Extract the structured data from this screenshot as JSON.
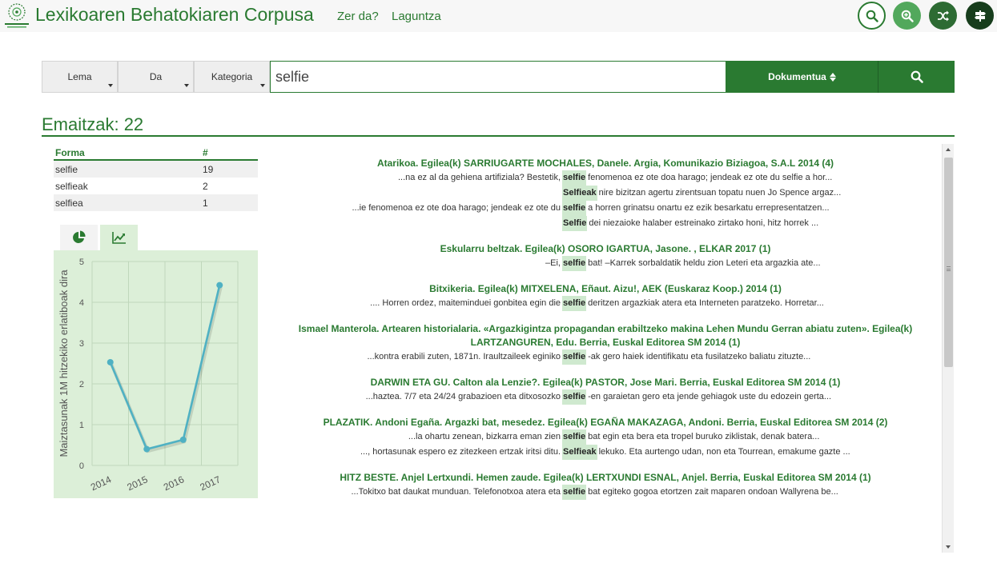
{
  "header": {
    "title": "Lexikoaren Behatokiaren Corpusa",
    "nav": [
      "Zer da?",
      "Laguntza"
    ],
    "icons": [
      "search-icon",
      "zoom-in-icon",
      "shuffle-icon",
      "signpost-icon"
    ],
    "colors": {
      "primary": "#2a7a31",
      "light": "#52a85c",
      "mid": "#2d6b33",
      "dark": "#173d1c"
    }
  },
  "search": {
    "dropdowns": [
      "Lema",
      "Da",
      "Kategoria"
    ],
    "query": "selfie",
    "sort_label": "Dokumentua"
  },
  "results": {
    "title": "Emaitzak: 22"
  },
  "forms": {
    "headers": [
      "Forma",
      "#"
    ],
    "rows": [
      {
        "form": "selfie",
        "count": "19"
      },
      {
        "form": "selfieak",
        "count": "2"
      },
      {
        "form": "selfiea",
        "count": "1"
      }
    ]
  },
  "chart_tabs": [
    "pie-chart-icon",
    "line-chart-icon"
  ],
  "chart_data": {
    "type": "line",
    "categories": [
      "2014",
      "2015",
      "2016",
      "2017"
    ],
    "series": [
      {
        "values": [
          2.53,
          0.4,
          0.63,
          4.42
        ]
      }
    ],
    "ylabel": "Maiztasunak 1M hitzekiko erlatiboak dira",
    "xlabel": "",
    "ylim": [
      0,
      5
    ],
    "yticks": [
      "0",
      "1",
      "2",
      "3",
      "4",
      "5"
    ],
    "grid": true,
    "line_color": "#4fb1c3"
  },
  "documents": [
    {
      "title": "Atarikoa. Egilea(k) SARRIUGARTE MOCHALES, Danele. Argia, Komunikazio Biziagoa, S.A.L 2014 (4)",
      "lines": [
        {
          "left": "...na ez al da gehiena artifiziala? Bestetik,",
          "kw": "selfie",
          "right": "fenomenoa ez ote doa harago; jendeak ez ote du selfie a hor..."
        },
        {
          "left": "",
          "kw": "Selfieak",
          "right": "nire bizitzan agertu zirentsuan topatu nuen Jo Spence argaz..."
        },
        {
          "left": "...ie fenomenoa ez ote doa harago; jendeak ez ote du",
          "kw": "selfie",
          "right": "a horren grinatsu onartu ez ezik besarkatu errepresentatzen..."
        },
        {
          "left": "",
          "kw": "Selfie",
          "right": "dei niezaioke halaber estreinako zirtako honi, hitz horrek ..."
        }
      ]
    },
    {
      "title": "Eskularru beltzak. Egilea(k) OSORO IGARTUA, Jasone. , ELKAR 2017 (1)",
      "lines": [
        {
          "left": "–Ei,",
          "kw": "selfie",
          "right": "bat! –Karrek sorbaldatik heldu zion Leteri eta argazkia ate..."
        }
      ]
    },
    {
      "title": "Bitxikeria. Egilea(k) MITXELENA, Eñaut. Aizu!, AEK (Euskaraz Koop.) 2014 (1)",
      "lines": [
        {
          "left": ".... Horren ordez, maiteminduei gonbitea egin die",
          "kw": "selfie",
          "right": "deritzen argazkiak atera eta Interneten paratzeko. Horretar..."
        }
      ]
    },
    {
      "title": "Ismael Manterola. Artearen historialaria. «Argazkigintza propagandan erabiltzeko makina Lehen Mundu Gerran abiatu zuten». Egilea(k) LARTZANGUREN, Edu. Berria, Euskal Editorea SM 2014 (1)",
      "lines": [
        {
          "left": "...kontra erabili zuten, 1871n. Iraultzaileek eginiko",
          "kw": "selfie",
          "right": "-ak gero haiek identifikatu eta fusilatzeko baliatu zituzte..."
        }
      ]
    },
    {
      "title": "DARWIN ETA GU. Calton ala Lenzie?. Egilea(k) PASTOR, Jose Mari. Berria, Euskal Editorea SM 2014 (1)",
      "lines": [
        {
          "left": "...haztea. 7/7 eta 24/24 grabazioen eta ditxosozko",
          "kw": "selfie",
          "right": "-en garaietan gero eta jende gehiagok uste du edozein gerta..."
        }
      ]
    },
    {
      "title": "PLAZATIK. Andoni Egaña. Argazki bat, mesedez. Egilea(k) EGAÑA MAKAZAGA, Andoni. Berria, Euskal Editorea SM 2014 (2)",
      "lines": [
        {
          "left": "...la ohartu zenean, bizkarra eman zien",
          "kw": "selfie",
          "right": "bat egin eta bera eta tropel buruko ziklistak, denak batera..."
        },
        {
          "left": "..., hortasunak espero ez zitezkeen ertzak iritsi ditu.",
          "kw": "Selfieak",
          "right": "lekuko. Eta aurtengo udan, non eta Tourrean, emakume gazte ..."
        }
      ]
    },
    {
      "title": "HITZ BESTE. Anjel Lertxundi. Hemen zaude. Egilea(k) LERTXUNDI ESNAL, Anjel. Berria, Euskal Editorea SM 2014 (1)",
      "lines": [
        {
          "left": "...Tokitxo bat daukat munduan. Telefonotxoa atera eta",
          "kw": "selfie",
          "right": "bat egiteko gogoa etortzen zait maparen ondoan Wallyrena be..."
        }
      ]
    }
  ]
}
